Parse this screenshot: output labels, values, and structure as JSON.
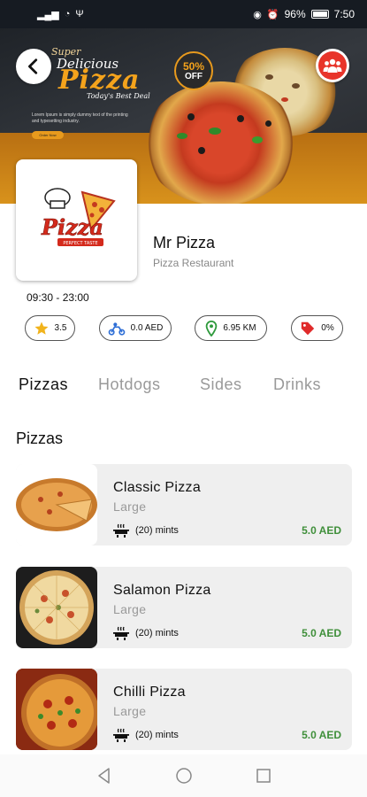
{
  "status_bar": {
    "battery": "96%",
    "time": "7:50"
  },
  "banner": {
    "super": "Super",
    "delicious": "Delicious",
    "pizza": "Pizza",
    "best_deal": "Today's Best Deal",
    "lorem": "Lorem Ipsum is simply dummy text of the printing and typesetting industry.",
    "order_now": "Order Now",
    "discount_pct": "50%",
    "discount_off": "OFF"
  },
  "logo": {
    "word": "Pizza",
    "tagline": "PERFECT TASTE"
  },
  "restaurant": {
    "name": "Mr Pizza",
    "type": "Pizza Restaurant",
    "hours": "09:30 - 23:00"
  },
  "chips": {
    "rating": "3.5",
    "delivery_fee": "0.0 AED",
    "distance": "6.95 KM",
    "discount": "0%"
  },
  "tabs": [
    "Pizzas",
    "Hotdogs",
    "Sides",
    "Drinks"
  ],
  "section_title": "Pizzas",
  "items": [
    {
      "name": "Classic Pizza",
      "size": "Large",
      "time": "(20) mints",
      "price": "5.0 AED"
    },
    {
      "name": "Salamon Pizza",
      "size": "Large",
      "time": "(20) mints",
      "price": "5.0 AED"
    },
    {
      "name": "Chilli Pizza",
      "size": "Large",
      "time": "(20) mints",
      "price": "5.0 AED"
    }
  ],
  "colors": {
    "accent_red": "#e8342a",
    "price_green": "#3f8f3a",
    "banner_orange": "#d8921c"
  },
  "icons": [
    "back-arrow-icon",
    "group-icon",
    "star-icon",
    "scooter-icon",
    "location-pin-icon",
    "tag-icon",
    "cooking-pot-icon"
  ]
}
